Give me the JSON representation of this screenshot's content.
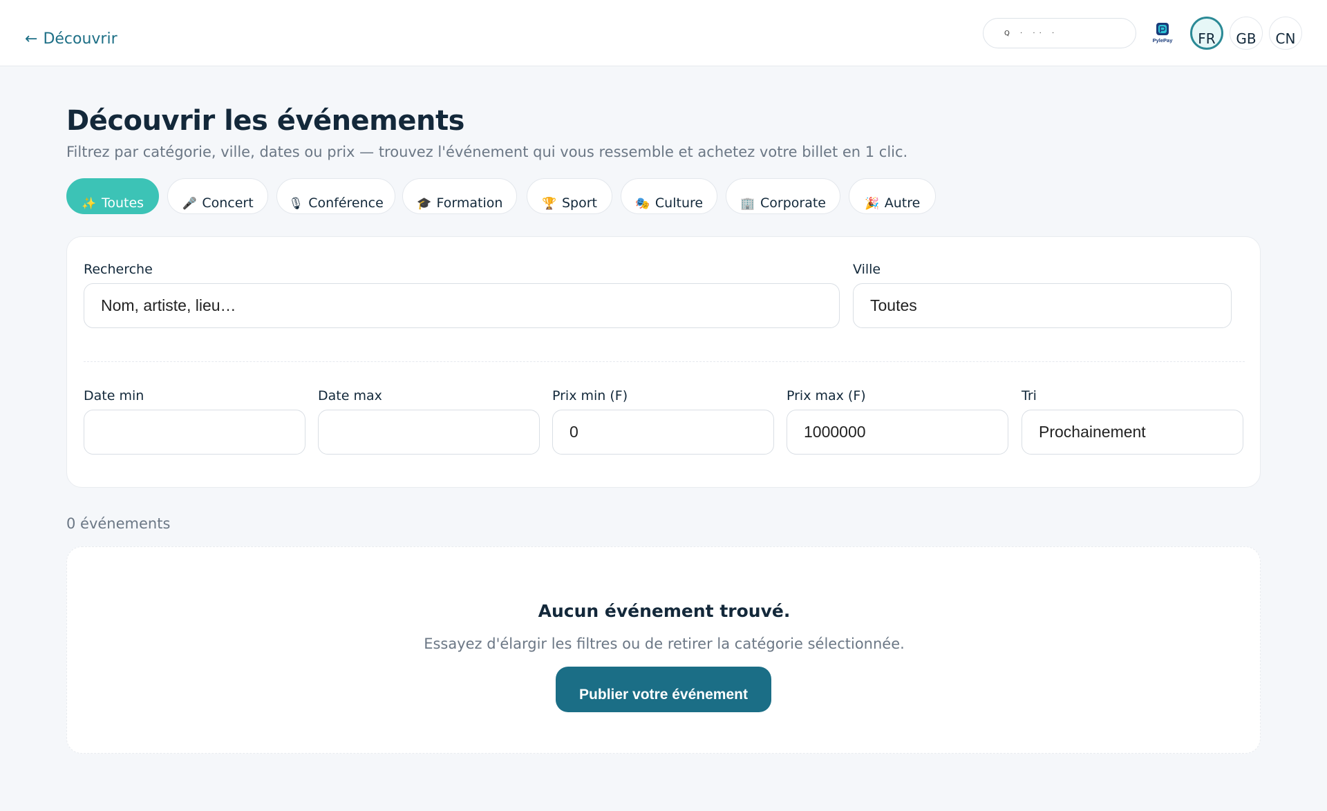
{
  "header": {
    "back_arrow": "←",
    "back_label": "Découvrir",
    "search_text": "Q   ·   ··   ·",
    "pay_logo_text": "PylePay",
    "languages": [
      "FR",
      "GB",
      "CN"
    ],
    "active_language": "FR"
  },
  "page": {
    "title": "Découvrir les événements",
    "subtitle": "Filtrez par catégorie, ville, dates ou prix — trouvez l'événement qui vous ressemble et achetez votre billet en 1 clic."
  },
  "categories": [
    {
      "label": "Toutes",
      "icon": "✨",
      "icon_name": "sparkles-icon",
      "active": true
    },
    {
      "label": "Concert",
      "icon": "🎤",
      "icon_name": "microphone-icon",
      "active": false
    },
    {
      "label": "Conférence",
      "icon": "🎙",
      "icon_name": "studio-mic-icon",
      "active": false
    },
    {
      "label": "Formation",
      "icon": "🎓",
      "icon_name": "graduation-cap-icon",
      "active": false
    },
    {
      "label": "Sport",
      "icon": "🏆",
      "icon_name": "trophy-icon",
      "active": false
    },
    {
      "label": "Culture",
      "icon": "🎭",
      "icon_name": "theater-masks-icon",
      "active": false
    },
    {
      "label": "Corporate",
      "icon": "🏢",
      "icon_name": "office-building-icon",
      "active": false
    },
    {
      "label": "Autre",
      "icon": "🎉",
      "icon_name": "party-popper-icon",
      "active": false
    }
  ],
  "filters": {
    "search": {
      "label": "Recherche",
      "placeholder": "Nom, artiste, lieu…",
      "value": ""
    },
    "city": {
      "label": "Ville",
      "value": "Toutes"
    },
    "date_min": {
      "label": "Date min",
      "value": ""
    },
    "date_max": {
      "label": "Date max",
      "value": ""
    },
    "price_min": {
      "label": "Prix min (F)",
      "value": "0"
    },
    "price_max": {
      "label": "Prix max (F)",
      "value": "1000000"
    },
    "sort": {
      "label": "Tri",
      "value": "Prochainement"
    }
  },
  "results": {
    "count_text": "0 événements"
  },
  "empty_state": {
    "title": "Aucun événement trouvé.",
    "text": "Essayez d'élargir les filtres ou de retirer la catégorie sélectionnée.",
    "button_label": "Publier votre événement"
  },
  "colors": {
    "accent": "#3cc3b6",
    "primary": "#1b6e86",
    "link": "#1d6f86",
    "background": "#f5f7fa"
  }
}
